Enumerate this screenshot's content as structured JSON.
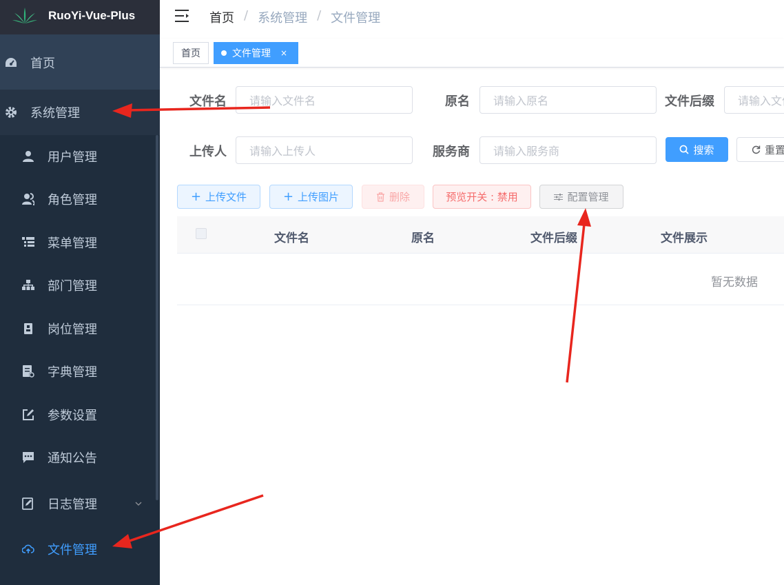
{
  "app": {
    "title": "RuoYi-Vue-Plus"
  },
  "sidebar": {
    "items": [
      {
        "label": "首页",
        "icon": "dashboard-icon"
      },
      {
        "label": "系统管理",
        "icon": "gear-icon"
      },
      {
        "label": "用户管理",
        "icon": "user-icon"
      },
      {
        "label": "角色管理",
        "icon": "peoples-icon"
      },
      {
        "label": "菜单管理",
        "icon": "tree-table-icon"
      },
      {
        "label": "部门管理",
        "icon": "tree-icon"
      },
      {
        "label": "岗位管理",
        "icon": "post-icon"
      },
      {
        "label": "字典管理",
        "icon": "dict-icon"
      },
      {
        "label": "参数设置",
        "icon": "edit-icon"
      },
      {
        "label": "通知公告",
        "icon": "message-icon"
      },
      {
        "label": "日志管理",
        "icon": "log-icon"
      },
      {
        "label": "文件管理",
        "icon": "upload-icon"
      }
    ]
  },
  "breadcrumb": {
    "items": [
      "首页",
      "系统管理",
      "文件管理"
    ],
    "separator": "/"
  },
  "tags": {
    "home": "首页",
    "active": "文件管理",
    "close": "×"
  },
  "search": {
    "filename_label": "文件名",
    "filename_placeholder": "请输入文件名",
    "originalname_label": "原名",
    "originalname_placeholder": "请输入原名",
    "suffix_label": "文件后缀",
    "suffix_placeholder": "请输入文件后缀",
    "uploader_label": "上传人",
    "uploader_placeholder": "请输入上传人",
    "service_label": "服务商",
    "service_placeholder": "请输入服务商",
    "search_button": "搜索",
    "reset_button": "重置"
  },
  "toolbar": {
    "upload_file": "上传文件",
    "upload_image": "上传图片",
    "delete": "删除",
    "preview_toggle": "预览开关 : 禁用",
    "config": "配置管理"
  },
  "table": {
    "columns": [
      "文件名",
      "原名",
      "文件后缀",
      "文件展示"
    ],
    "empty_text": "暂无数据"
  },
  "colors": {
    "primary": "#409eff",
    "sidebar": "#304156",
    "submenu": "#1f2d3d",
    "annotation": "#e8261e"
  }
}
